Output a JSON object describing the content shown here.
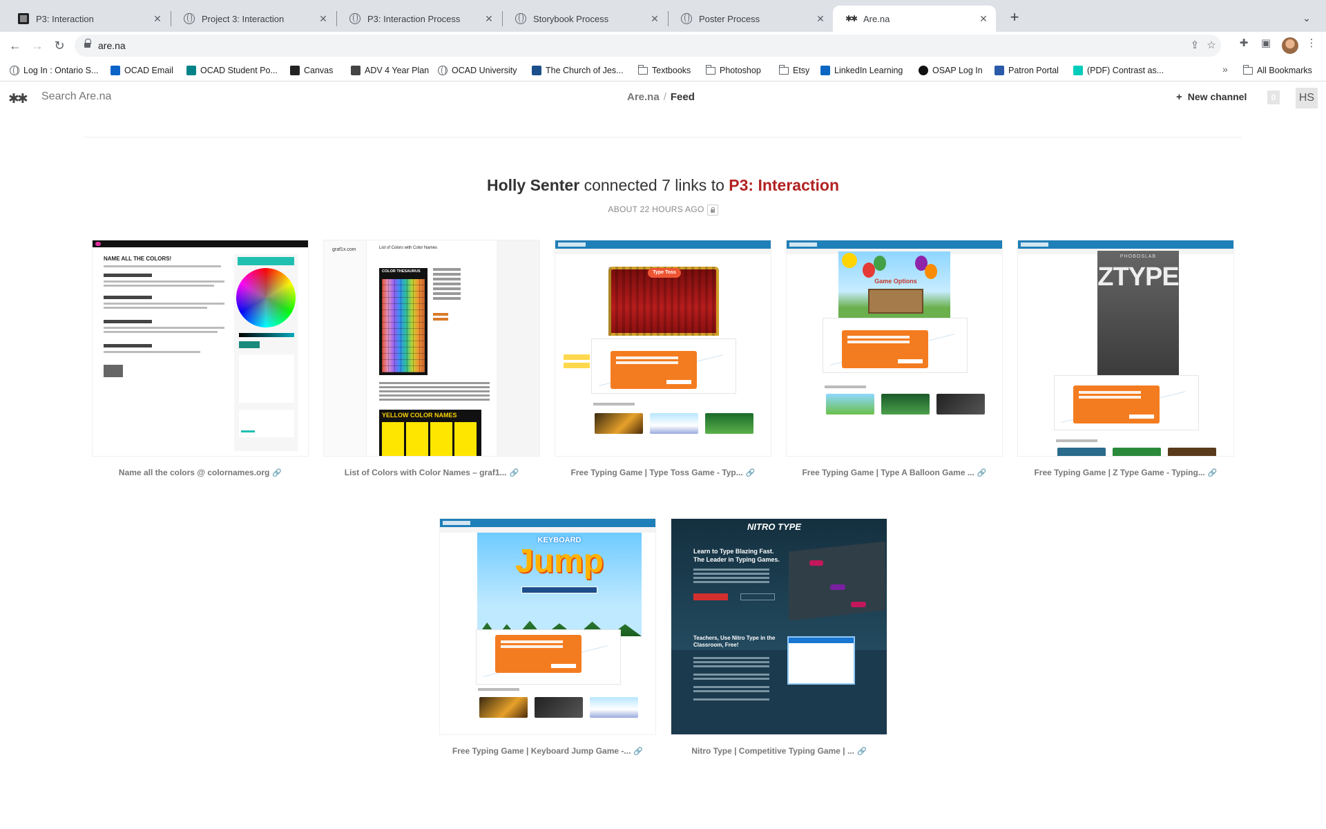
{
  "browser": {
    "tabs": [
      {
        "label": "P3: Interaction",
        "icon": "arena-dark-favicon",
        "active": false
      },
      {
        "label": "Project 3: Interaction",
        "icon": "globe-icon",
        "active": false
      },
      {
        "label": "P3: Interaction Process",
        "icon": "globe-icon",
        "active": false
      },
      {
        "label": "Storybook Process",
        "icon": "globe-icon",
        "active": false
      },
      {
        "label": "Poster Process",
        "icon": "globe-icon",
        "active": false
      },
      {
        "label": "Are.na",
        "icon": "arena-logo-favicon",
        "active": true
      }
    ],
    "url": "are.na",
    "bookmarks": [
      {
        "label": "Log In : Ontario S...",
        "icon": "globe-icon"
      },
      {
        "label": "OCAD Email",
        "icon": "outlook-icon",
        "color": "#0a64c8"
      },
      {
        "label": "OCAD Student Po...",
        "icon": "sharepoint-icon",
        "color": "#038387"
      },
      {
        "label": "Canvas",
        "icon": "canvas-icon",
        "color": "#222222"
      },
      {
        "label": "ADV 4 Year Plan",
        "icon": "google-sheets-icon",
        "color": "#444444"
      },
      {
        "label": "OCAD University",
        "icon": "globe-icon"
      },
      {
        "label": "The Church of Jes...",
        "icon": "church-icon",
        "color": "#1b4f8a"
      },
      {
        "label": "Textbooks",
        "icon": "folder-icon"
      },
      {
        "label": "Photoshop",
        "icon": "folder-icon"
      },
      {
        "label": "Etsy",
        "icon": "folder-icon"
      },
      {
        "label": "LinkedIn Learning",
        "icon": "linkedin-icon",
        "color": "#0a66c2"
      },
      {
        "label": "OSAP Log In",
        "icon": "osap-icon",
        "color": "#111111"
      },
      {
        "label": "Patron Portal",
        "icon": "patron-icon",
        "color": "#2a5aa8"
      },
      {
        "label": "(PDF) Contrast as...",
        "icon": "researchgate-icon",
        "color": "#00ccbb"
      }
    ],
    "all_bookmarks_label": "All Bookmarks"
  },
  "arena": {
    "logo": "✱✱",
    "search_placeholder": "Search Are.na",
    "breadcrumb": {
      "root": "Are.na",
      "sep": "/",
      "current": "Feed"
    },
    "new_channel_label": "New channel",
    "notification_count": "0",
    "user_initials": "HS"
  },
  "feed": {
    "user": "Holly Senter",
    "action": "connected 7 links to",
    "channel": "P3: Interaction",
    "channel_color": "#b22222",
    "time": "ABOUT 22 HOURS AGO",
    "blocks": [
      {
        "title": "Name all the colors @ colornames.org",
        "kind": "colornames"
      },
      {
        "title": "List of Colors with Color Names – graf1...",
        "kind": "graf1x"
      },
      {
        "title": "Free Typing Game | Type Toss Game - Typ...",
        "kind": "typetoss"
      },
      {
        "title": "Free Typing Game | Type A Balloon Game ...",
        "kind": "balloon"
      },
      {
        "title": "Free Typing Game | Z Type Game - Typing...",
        "kind": "ztype"
      },
      {
        "title": "Free Typing Game | Keyboard Jump Game -...",
        "kind": "keyboardjump"
      },
      {
        "title": "Nitro Type | Competitive Typing Game | ...",
        "kind": "nitro"
      }
    ],
    "thumb_text": {
      "colornames_heading": "NAME ALL THE COLORS!",
      "graf1x_logo": "graf1x.com",
      "graf1x_title": "List of Colors with Color Names",
      "graf1x_box1": "COLOR THESAURUS",
      "graf1x_box2": "YELLOW COLOR NAMES",
      "typetoss_sign": "Type Toss",
      "balloon_sign": "Game Options",
      "ztype_brand": "PHOBOSLAB",
      "ztype_title": "ZTYPE",
      "kj_title1": "KEYBOARD",
      "kj_title2": "Jump",
      "nitro_logo": "NITRO TYPE",
      "nitro_h1": "Learn to Type Blazing Fast.",
      "nitro_h2": "The Leader in Typing Games.",
      "nitro_h3": "Teachers, Use Nitro Type in the Classroom, Free!"
    }
  }
}
